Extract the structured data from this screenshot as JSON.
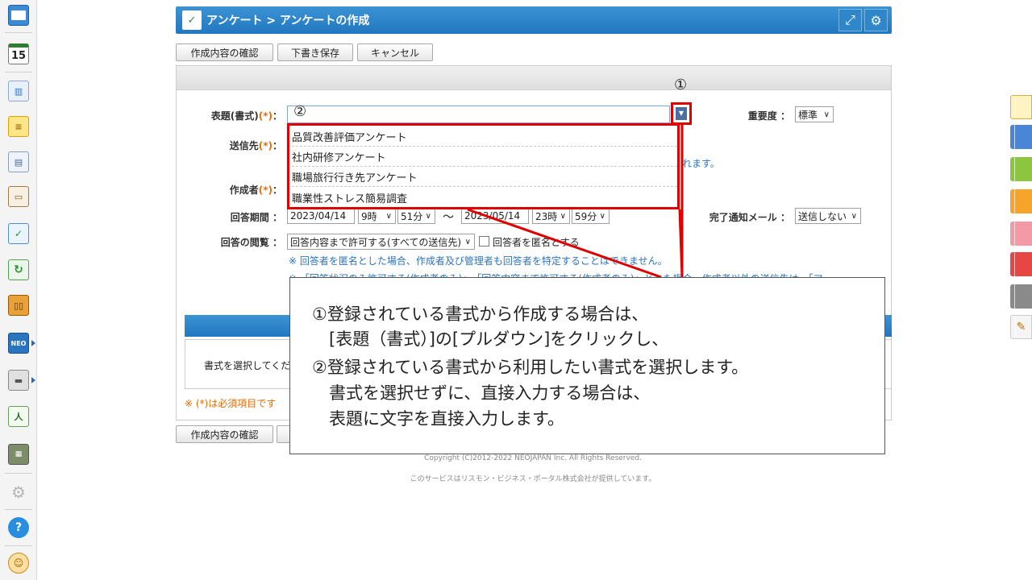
{
  "header": {
    "title": "アンケート > アンケートの作成"
  },
  "toolbar": {
    "confirm": "作成内容の確認",
    "draft": "下書き保存",
    "cancel": "キャンセル"
  },
  "form": {
    "subject_label": "表題(書式)",
    "required_mark": "(*)",
    "colon": "：",
    "recipients_label": "送信先",
    "author_label": "作成者",
    "period_label": "回答期間",
    "start_date": "2023/04/14",
    "start_hour": "9時",
    "start_min": "51分",
    "tilde": "～",
    "end_date": "2023/05/14",
    "end_hour": "23時",
    "end_min": "59分",
    "view_label": "回答の閲覧",
    "view_value": "回答内容まで許可する(すべての送信先)",
    "anon_label": "回答者を匿名とする",
    "note1": "※ 回答者を匿名とした場合、作成者及び管理者も回答者を特定することはできません。",
    "note2": "※ 「回答状況のみ許可する(作成者のみ)」、「回答内容まで許可する(作成者のみ)」とした場合、作成者以外の送信先は、「ア",
    "recipients_note": "れます。",
    "priority_label": "重要度",
    "priority_value": "標準",
    "mail_label": "完了通知メール",
    "mail_value": "送信しない",
    "select_format_text": "書式を選択してくだ",
    "required_note": "※ (*)は必須項目です"
  },
  "dropdown": {
    "items": [
      "品質改善評価アンケート",
      "社内研修アンケート",
      "職場旅行行き先アンケート",
      "職業性ストレス簡易調査"
    ]
  },
  "markers": {
    "one": "①",
    "two": "②"
  },
  "callout": {
    "lines": [
      "①登録されている書式から作成する場合は、",
      "　[表題（書式）]の[プルダウン]をクリックし、",
      "②登録されている書式から利用したい書式を選択します。",
      "　書式を選択せずに、直接入力する場合は、",
      "　表題に文字を直接入力します。"
    ]
  },
  "footer": {
    "copyright": "Copyright (C)2012-2022 NEOJAPAN Inc. All Rights Reserved.",
    "service": "このサービスはリスモン・ビジネス・ポータル株式会社が提供しています。"
  },
  "sidebar": {
    "calendar_day": "15",
    "neo": "NEO",
    "help": "?"
  },
  "colors": {
    "accent": "#2277bf",
    "highlight": "#e00000",
    "required": "#e86b00",
    "note": "#2a74c0"
  }
}
